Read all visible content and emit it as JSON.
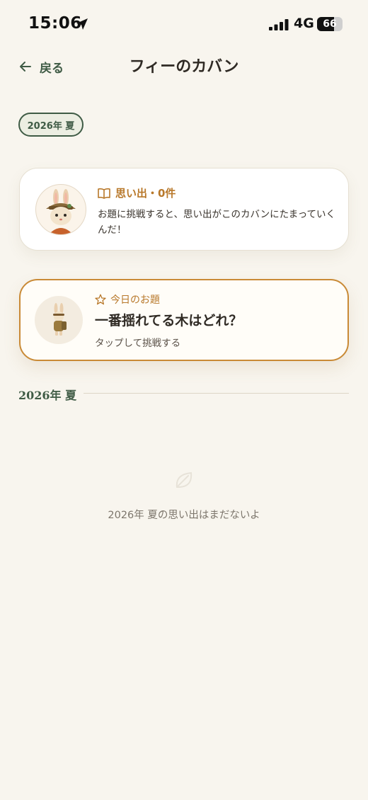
{
  "status_bar": {
    "time": "15:06",
    "network": "4G",
    "battery_level": "66",
    "battery_fraction": 0.66
  },
  "header": {
    "back_label": "戻る",
    "title": "フィーのカバン"
  },
  "season_chip": {
    "label": "2026年 夏"
  },
  "memories_card": {
    "title": "思い出・0件",
    "description": "お題に挑戦すると、思い出がこのカバンにたまっていくんだ！"
  },
  "challenge_card": {
    "label": "今日のお題",
    "title": "一番揺れてる木はどれ？",
    "hint": "タップして挑戦する"
  },
  "section": {
    "label": "2026年 夏"
  },
  "empty_state": {
    "message": "2026年 夏の思い出はまだないよ"
  },
  "colors": {
    "background": "#f8f5ee",
    "accent_green": "#3f5b45",
    "accent_orange": "#b8782a",
    "card_border_orange": "#c98a36"
  },
  "icons": {
    "back": "arrow-left-icon",
    "book": "open-book-icon",
    "star": "star-outline-icon",
    "location": "location-arrow-icon",
    "signal": "signal-bars-icon",
    "empty": "leaf-icon"
  }
}
